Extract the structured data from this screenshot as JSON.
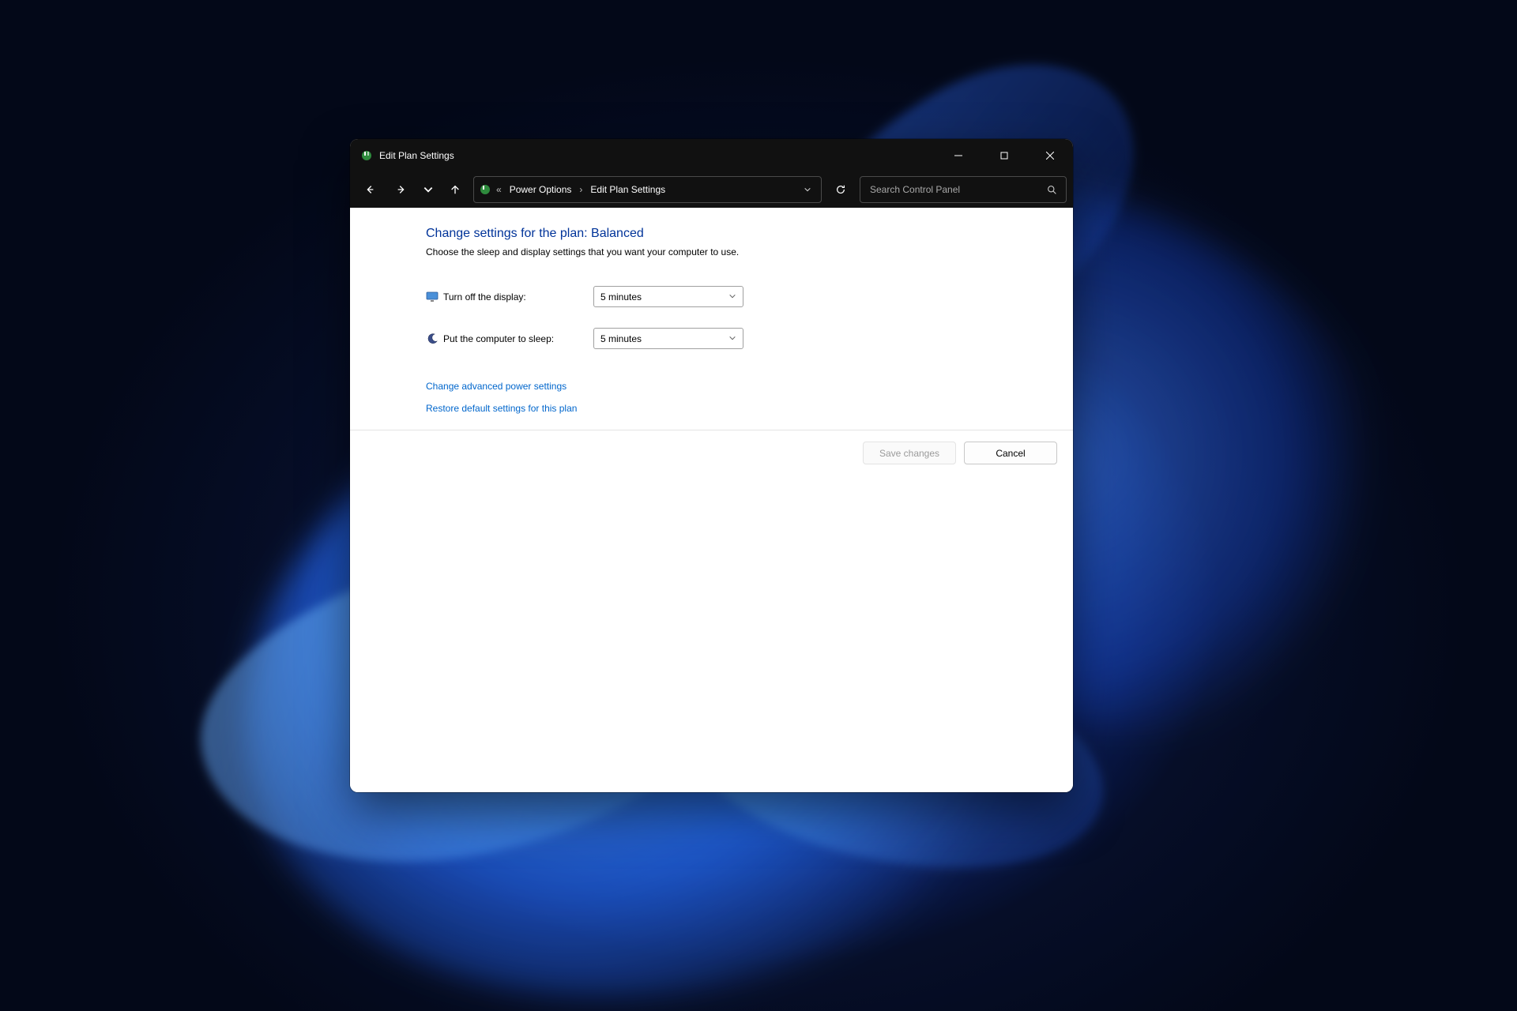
{
  "window": {
    "title": "Edit Plan Settings"
  },
  "breadcrumb": {
    "prefix_glyph": "«",
    "item1": "Power Options",
    "item2": "Edit Plan Settings"
  },
  "search": {
    "placeholder": "Search Control Panel"
  },
  "page": {
    "heading": "Change settings for the plan: Balanced",
    "subheading": "Choose the sleep and display settings that you want your computer to use.",
    "turn_off_display_label": "Turn off the display:",
    "turn_off_display_value": "5 minutes",
    "sleep_label": "Put the computer to sleep:",
    "sleep_value": "5 minutes"
  },
  "links": {
    "advanced": "Change advanced power settings",
    "restore": "Restore default settings for this plan"
  },
  "footer": {
    "save": "Save changes",
    "cancel": "Cancel"
  }
}
